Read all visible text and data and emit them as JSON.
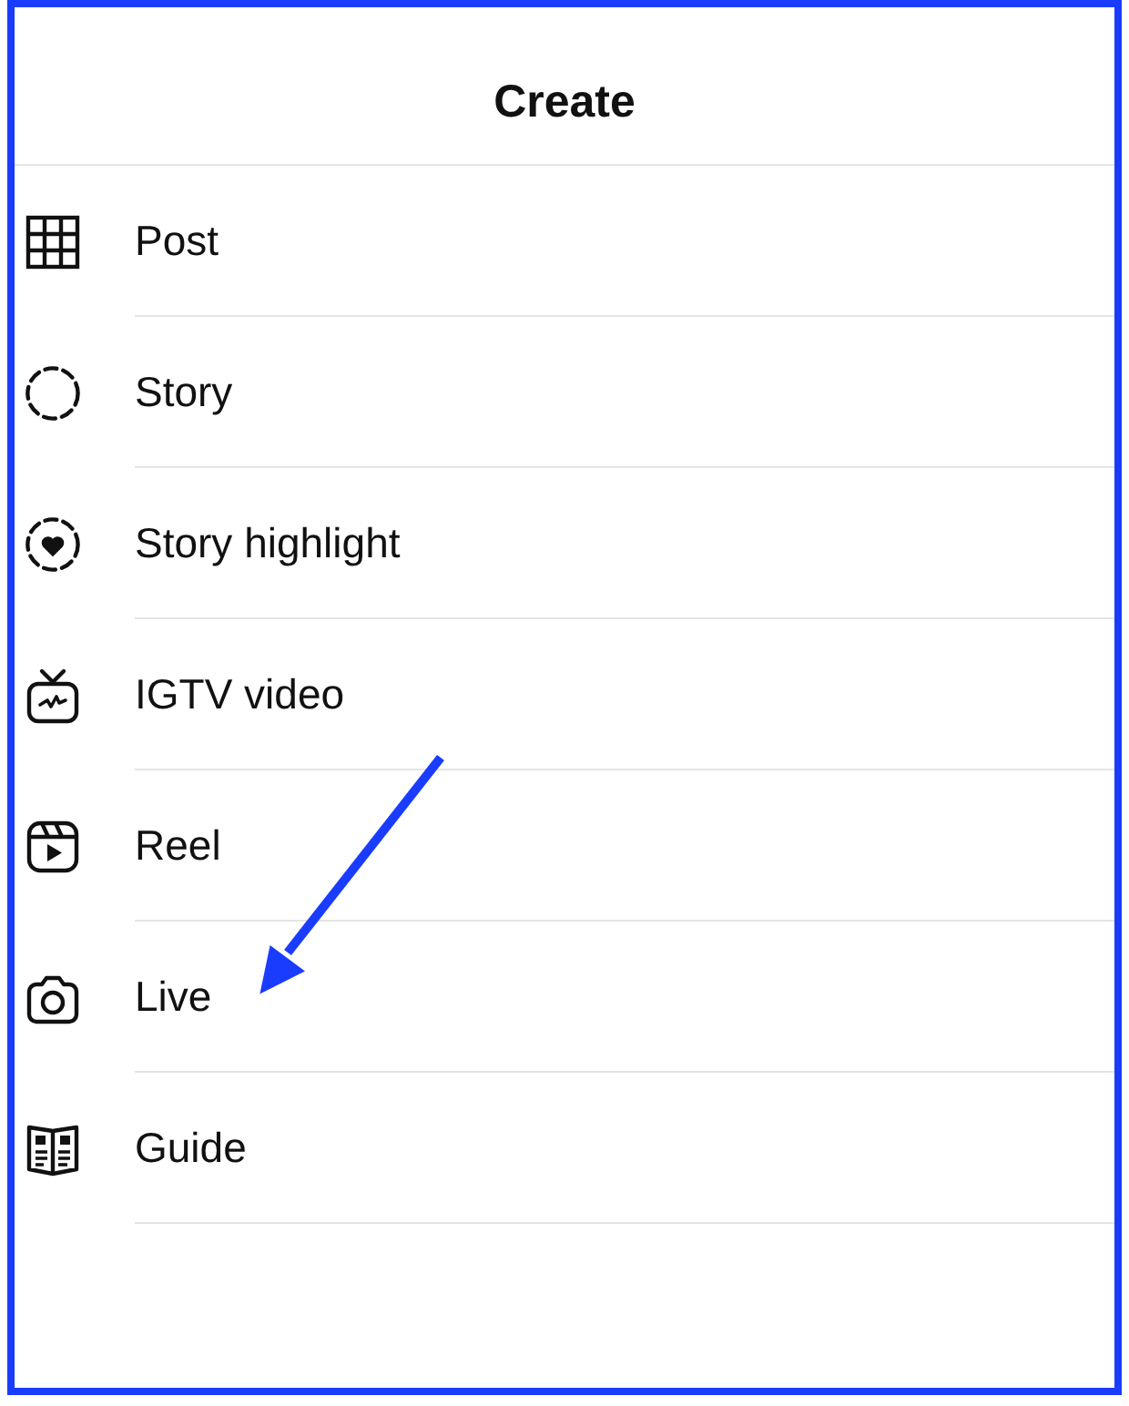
{
  "sheet": {
    "title": "Create",
    "items": [
      {
        "label": "Post",
        "kind": "post"
      },
      {
        "label": "Story",
        "kind": "story"
      },
      {
        "label": "Story highlight",
        "kind": "highlight"
      },
      {
        "label": "IGTV video",
        "kind": "igtv"
      },
      {
        "label": "Reel",
        "kind": "reel"
      },
      {
        "label": "Live",
        "kind": "live"
      },
      {
        "label": "Guide",
        "kind": "guide"
      }
    ]
  }
}
